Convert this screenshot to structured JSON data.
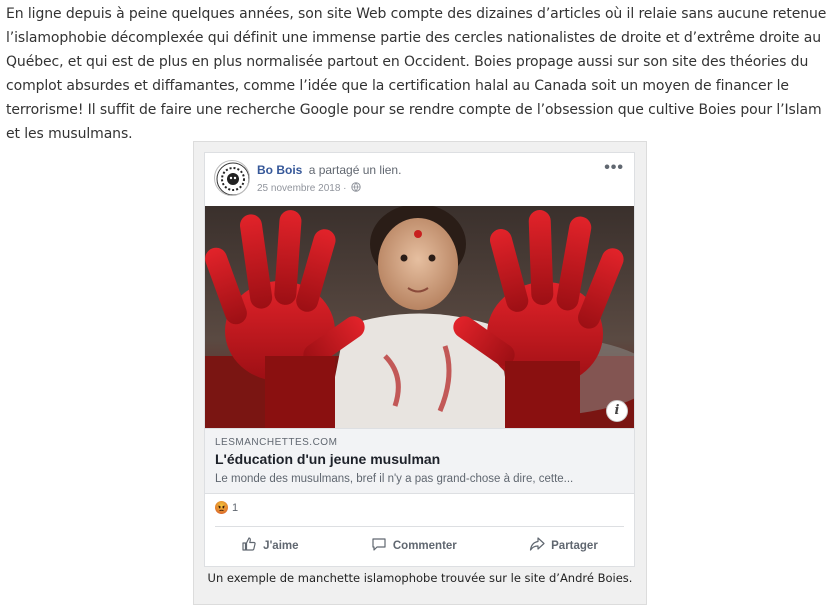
{
  "article": {
    "paragraph": "En ligne depuis à peine quelques années, son site Web compte des dizaines d’articles où il relaie sans aucune retenue l’islamophobie décomplexée qui définit une immense partie des cercles nationalistes de droite et d’extrême droite au Québec, et qui est de plus en plus normalisée partout en Occident. Boies propage aussi sur son site des théories du complot absurdes et diffamantes, comme l’idée que la certification halal au Canada soit un moyen de financer le terrorisme! Il suffit de faire une recherche Google pour se rendre compte de l’obsession que cultive Boies pour l’Islam et les musulmans."
  },
  "post": {
    "author": "Bo Bois",
    "action_text": "a partagé un lien.",
    "date": "25 novembre 2018 ·",
    "more_icon": "more-horizontal-icon",
    "photo_icon": "photo-of-child-with-red-painted-hands",
    "link": {
      "domain": "LESMANCHETTES.COM",
      "title": "L'éducation d'un jeune musulman",
      "description": "Le monde des musulmans, bref il n'y a pas grand-chose à dire, cette..."
    },
    "reactions": {
      "icon": "angry-reaction-icon",
      "count": "1"
    },
    "actions": {
      "like": "J'aime",
      "comment": "Commenter",
      "share": "Partager"
    }
  },
  "caption": "Un exemple de manchette islamophobe trouvée sur le site d’André Boies.",
  "colors": {
    "author_link": "#365899",
    "card_border": "#dddfe2",
    "link_bg": "#f2f3f5",
    "figure_bg": "#f0f0f0"
  }
}
